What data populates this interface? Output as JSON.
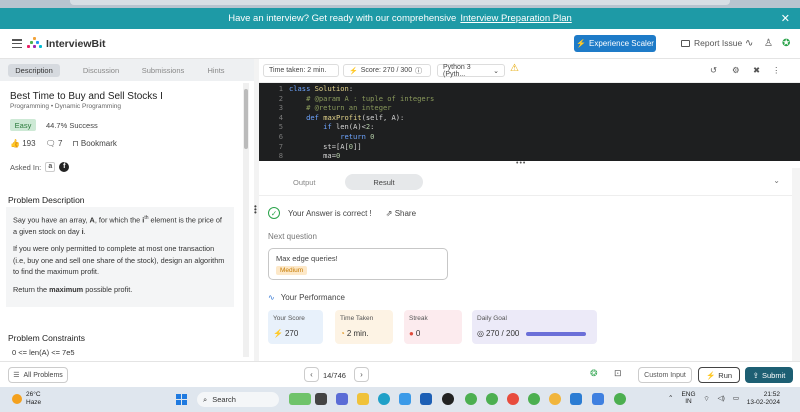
{
  "banner": {
    "text": "Have an interview? Get ready with our comprehensive",
    "link": "Interview Preparation Plan",
    "close": "✕"
  },
  "header": {
    "logo": "InterviewBit",
    "experience_btn": "Experience Scaler",
    "report": "Report Issue"
  },
  "left": {
    "tabs": [
      "Description",
      "Discussion",
      "Submissions",
      "Hints"
    ],
    "title": "Best Time to Buy and Sell Stocks I",
    "tags": "Programming • Dynamic Programming",
    "difficulty": "Easy",
    "success": "44.7% Success",
    "likes": "193",
    "dislikes": "7",
    "bookmark": "Bookmark",
    "asked_in": "Asked In:",
    "companies": [
      "a",
      "f"
    ],
    "desc_heading": "Problem Description",
    "desc_p1_a": "Say you have an array,",
    "desc_p1_b": "A",
    "desc_p1_c": ", for which the",
    "desc_p1_d": "i",
    "desc_p1_e": "th",
    "desc_p1_f": "element is the price of a given stock on day",
    "desc_p1_g": "i",
    "desc_p2": "If you were only permitted to complete at most one transaction (i.e, buy one and sell one share of the stock), design an algorithm to find the maximum profit.",
    "desc_p3_a": "Return the",
    "desc_p3_b": "maximum",
    "desc_p3_c": "possible profit.",
    "cons_heading": "Problem Constraints",
    "cons_1": "0 <= len(A) <= 7e5"
  },
  "editor": {
    "time": "Time taken: 2 min.",
    "score": "Score: 270 / 300",
    "language": "Python 3 (Pyth...",
    "line_numbers": [
      "1",
      "2",
      "3",
      "4",
      "5",
      "6",
      "7",
      "8"
    ]
  },
  "result": {
    "tabs": [
      "Output",
      "Result"
    ],
    "correct": "Your Answer is correct !",
    "share": "Share",
    "next_label": "Next question",
    "next_title": "Max edge queries!",
    "next_difficulty": "Medium",
    "perf_label": "Your Performance",
    "stats": [
      {
        "label": "Your Score",
        "value": "270"
      },
      {
        "label": "Time Taken",
        "value": "2 min."
      },
      {
        "label": "Streak",
        "value": "0"
      },
      {
        "label": "Daily Goal",
        "value": "270 / 200"
      }
    ]
  },
  "bottom": {
    "all_problems": "All Problems",
    "page": "14/746",
    "custom_input": "Custom Input",
    "run": "Run",
    "submit": "Submit"
  },
  "taskbar": {
    "temp": "26°C",
    "weather": "Haze",
    "search": "Search",
    "lang1": "ENG",
    "lang2": "IN",
    "time": "21:52",
    "date": "13-02-2024"
  }
}
